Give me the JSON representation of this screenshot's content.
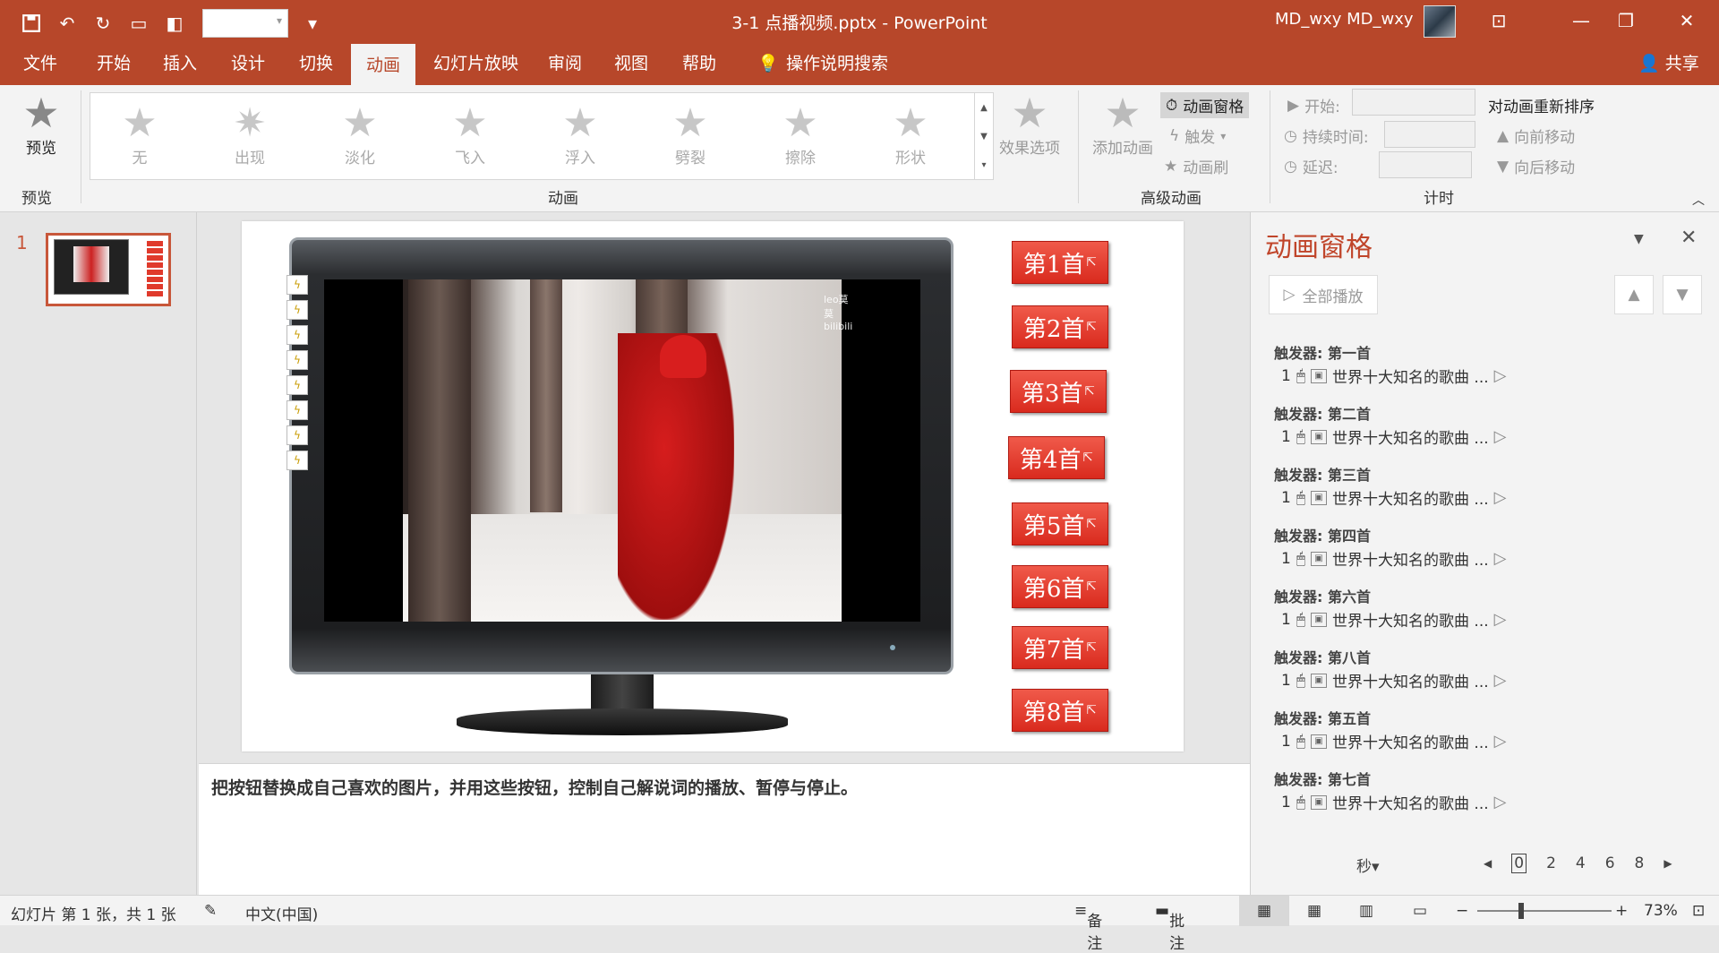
{
  "window": {
    "title": "3-1 点播视频.pptx  -  PowerPoint",
    "user": "MD_wxy MD_wxy"
  },
  "tabs": [
    {
      "label": "文件"
    },
    {
      "label": "开始"
    },
    {
      "label": "插入"
    },
    {
      "label": "设计"
    },
    {
      "label": "切换"
    },
    {
      "label": "动画"
    },
    {
      "label": "幻灯片放映"
    },
    {
      "label": "审阅"
    },
    {
      "label": "视图"
    },
    {
      "label": "帮助"
    },
    {
      "label": "操作说明搜索"
    }
  ],
  "share_label": "共享",
  "ribbon": {
    "preview_label": "预览",
    "preview_group": "预览",
    "animation_group": "动画",
    "advanced_group": "高级动画",
    "timing_group": "计时",
    "gallery": [
      "无",
      "出现",
      "淡化",
      "飞入",
      "浮入",
      "劈裂",
      "擦除",
      "形状"
    ],
    "effect_options": "效果选项",
    "add_animation": "添加动画",
    "animation_pane": "动画窗格",
    "trigger": "触发",
    "animation_painter": "动画刷",
    "start": "开始:",
    "duration": "持续时间:",
    "delay": "延迟:",
    "reorder": "对动画重新排序",
    "move_earlier": "向前移动",
    "move_later": "向后移动"
  },
  "thumbnail_number": "1",
  "slide": {
    "video_logo": "leo莫莫 bilibili",
    "buttons": [
      "第1首",
      "第2首",
      "第3首",
      "第4首",
      "第5首",
      "第6首",
      "第7首",
      "第8首"
    ]
  },
  "notes": "把按钮替换成自己喜欢的图片，并用这些按钮，控制自己解说词的播放、暂停与停止。",
  "animation_pane": {
    "title": "动画窗格",
    "play_all": "全部播放",
    "items": [
      {
        "trigger": "触发器: 第一首",
        "order": "1",
        "label": "世界十大知名的歌曲 ..."
      },
      {
        "trigger": "触发器: 第二首",
        "order": "1",
        "label": "世界十大知名的歌曲 ..."
      },
      {
        "trigger": "触发器: 第三首",
        "order": "1",
        "label": "世界十大知名的歌曲 ..."
      },
      {
        "trigger": "触发器: 第四首",
        "order": "1",
        "label": "世界十大知名的歌曲 ..."
      },
      {
        "trigger": "触发器: 第六首",
        "order": "1",
        "label": "世界十大知名的歌曲 ..."
      },
      {
        "trigger": "触发器: 第八首",
        "order": "1",
        "label": "世界十大知名的歌曲 ..."
      },
      {
        "trigger": "触发器: 第五首",
        "order": "1",
        "label": "世界十大知名的歌曲 ..."
      },
      {
        "trigger": "触发器: 第七首",
        "order": "1",
        "label": "世界十大知名的歌曲 ..."
      }
    ],
    "seconds_label": "秒",
    "timeline": [
      "0",
      "2",
      "4",
      "6",
      "8"
    ]
  },
  "status": {
    "slide_info": "幻灯片 第 1 张，共 1 张",
    "language": "中文(中国)",
    "notes": "备注",
    "comments": "批注",
    "zoom": "73%"
  },
  "colors": {
    "accent": "#b7472a",
    "button_red": "#e03a2c"
  }
}
